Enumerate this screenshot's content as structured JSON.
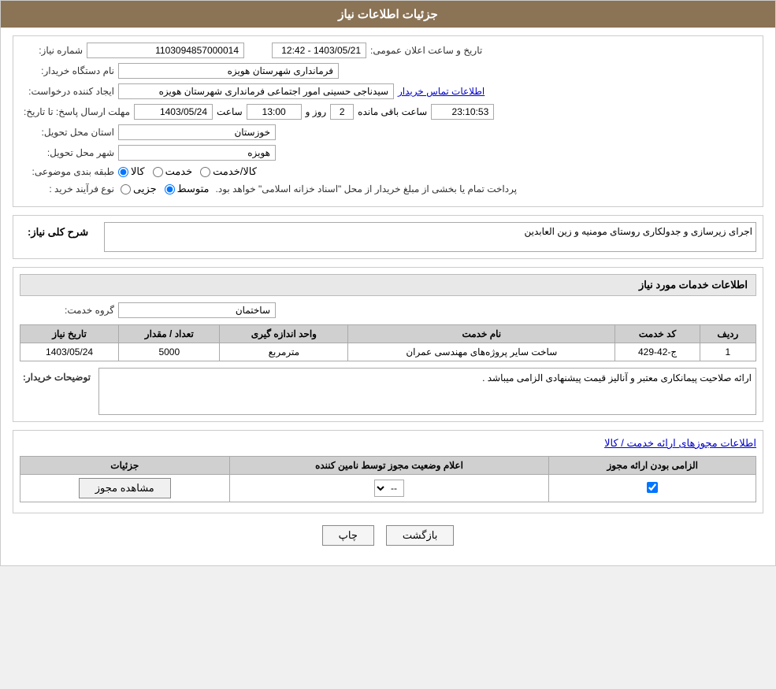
{
  "header": {
    "title": "جزئیات اطلاعات نیاز"
  },
  "need_details": {
    "need_number_label": "شماره نیاز:",
    "need_number_value": "1103094857000014",
    "announce_date_label": "تاریخ و ساعت اعلان عمومی:",
    "announce_date_value": "1403/05/21 - 12:42",
    "buyer_org_label": "نام دستگاه خریدار:",
    "buyer_org_value": "فرمانداری شهرستان هویزه",
    "creator_label": "ایجاد کننده درخواست:",
    "creator_value": "سیدناجی حسینی امور اجتماعی فرمانداری شهرستان هویزه",
    "creator_link": "اطلاعات تماس خریدار",
    "deadline_label": "مهلت ارسال پاسخ: تا تاریخ:",
    "deadline_date": "1403/05/24",
    "deadline_time_label": "ساعت",
    "deadline_time": "13:00",
    "deadline_days_label": "روز و",
    "deadline_days": "2",
    "deadline_remaining_label": "ساعت باقی مانده",
    "deadline_remaining": "23:10:53",
    "province_label": "استان محل تحویل:",
    "province_value": "خوزستان",
    "city_label": "شهر محل تحویل:",
    "city_value": "هویزه",
    "category_label": "طبقه بندی موضوعی:",
    "category_options": [
      {
        "label": "کالا",
        "value": "kala"
      },
      {
        "label": "خدمت",
        "value": "khedmat"
      },
      {
        "label": "کالا/خدمت",
        "value": "kala_khedmat"
      }
    ],
    "category_selected": "kala",
    "process_type_label": "نوع فرآیند خرید :",
    "process_options": [
      {
        "label": "جزیی",
        "value": "joz"
      },
      {
        "label": "متوسط",
        "value": "motas"
      }
    ],
    "process_selected": "motas",
    "process_note": "پرداخت تمام یا بخشی از مبلغ خریدار از محل \"اسناد خزانه اسلامی\" خواهد بود."
  },
  "general_description": {
    "section_title": "شرح کلی نیاز:",
    "description_value": "اجرای زیرسازی و جدولکاری روستای مومنیه و زین العابدین"
  },
  "service_info": {
    "section_title": "اطلاعات خدمات مورد نیاز",
    "group_service_label": "گروه خدمت:",
    "group_service_value": "ساختمان",
    "table_headers": {
      "row_num": "ردیف",
      "service_code": "کد خدمت",
      "service_name": "نام خدمت",
      "unit": "واحد اندازه گیری",
      "qty": "تعداد / مقدار",
      "date": "تاریخ نیاز"
    },
    "table_rows": [
      {
        "row_num": "1",
        "service_code": "ج-42-429",
        "service_name": "ساخت سایر پروژه‌های مهندسی عمران",
        "unit": "مترمربع",
        "qty": "5000",
        "date": "1403/05/24"
      }
    ],
    "buyer_notes_label": "توضیحات خریدار:",
    "buyer_notes_value": "ارائه صلاحیت پیمانکاری معتبر و آنالیز قیمت پیشنهادی الزامی میباشد ."
  },
  "permission_section": {
    "section_title": "اطلاعات مجوزهای ارائه خدمت / کالا",
    "table_headers": {
      "mandatory": "الزامی بودن ارائه مجوز",
      "status": "اعلام وضعیت مجوز توسط نامین کننده",
      "details": "جزئیات"
    },
    "table_rows": [
      {
        "mandatory": true,
        "status": "--",
        "details_link": "مشاهده مجوز"
      }
    ]
  },
  "footer": {
    "print_button": "چاپ",
    "back_button": "بازگشت"
  }
}
